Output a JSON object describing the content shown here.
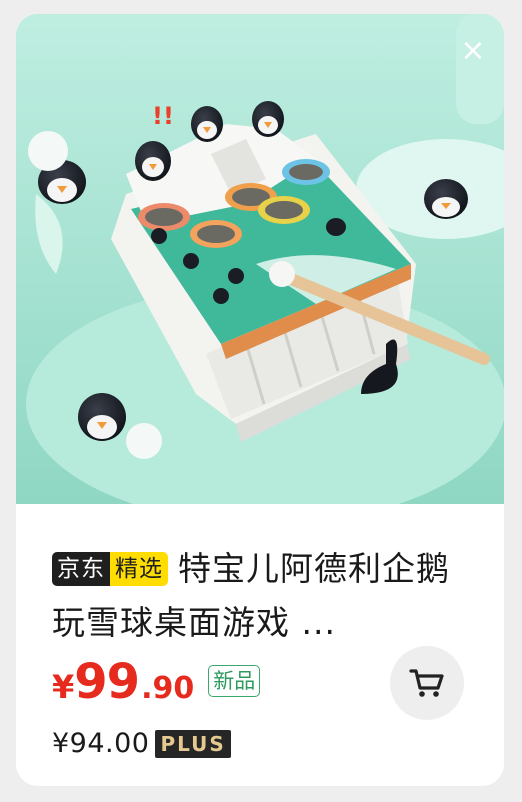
{
  "product": {
    "close_icon": "close-icon",
    "badge_jd": "京东",
    "badge_pick": "精选",
    "title": "特宝儿阿德利企鹅玩雪球桌面游戏 ...",
    "price_currency": "¥",
    "price_integer": "99",
    "price_decimal": ".90",
    "new_tag": "新品",
    "plus_price": "¥94.00",
    "plus_label": "PLUS",
    "cart_icon": "cart-icon"
  },
  "colors": {
    "price_red": "#e62a1e",
    "new_green": "#39a86b",
    "jd_black": "#1f1f1f",
    "pick_yellow": "#ffdd00",
    "plus_gold": "#e6c990",
    "image_bg": "#a9e4d4"
  }
}
